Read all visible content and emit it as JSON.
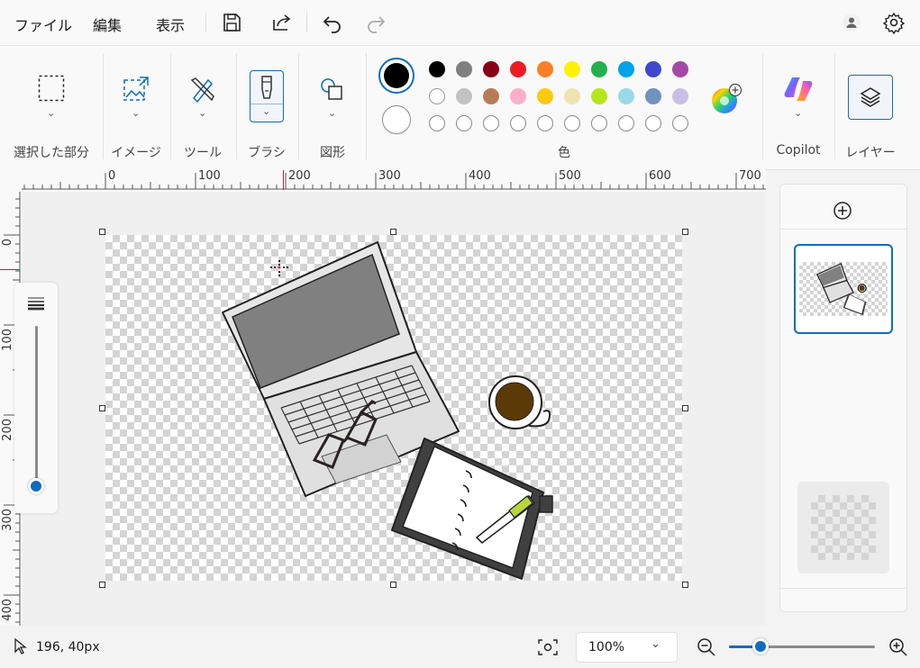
{
  "menu": {
    "file": "ファイル",
    "edit": "編集",
    "view": "表示",
    "save_icon": "save-icon",
    "share_icon": "share-icon",
    "undo_icon": "undo-icon",
    "redo_icon": "redo-icon",
    "account_icon": "account-icon",
    "settings_icon": "gear-icon"
  },
  "ribbon": {
    "groups": {
      "selection": "選択した部分",
      "image": "イメージ",
      "tools": "ツール",
      "brush": "ブラシ",
      "shapes": "図形",
      "colors": "色",
      "copilot": "Copilot",
      "layers": "レイヤー"
    },
    "primary_color": "#000000",
    "secondary_color": "#ffffff",
    "palette_row1": [
      "#000000",
      "#7f7f7f",
      "#880015",
      "#ed1c24",
      "#ff7f27",
      "#fff200",
      "#22b14c",
      "#00a2e8",
      "#3f48cc",
      "#a349a4"
    ],
    "palette_row2": [
      "#ffffff",
      "#c3c3c3",
      "#b97a57",
      "#ffaec9",
      "#ffc90e",
      "#efe4b0",
      "#b5e61d",
      "#99d9ea",
      "#7092be",
      "#c8bfe7"
    ],
    "palette_row3_count": 10
  },
  "rulers": {
    "horizontal": [
      "0",
      "100",
      "200",
      "300",
      "400",
      "500",
      "600",
      "700"
    ],
    "vertical": [
      "0",
      "100",
      "200",
      "300",
      "400"
    ]
  },
  "status": {
    "cursor_position": "196, 40px",
    "zoom": "100%",
    "zoom_level": 1.0
  }
}
